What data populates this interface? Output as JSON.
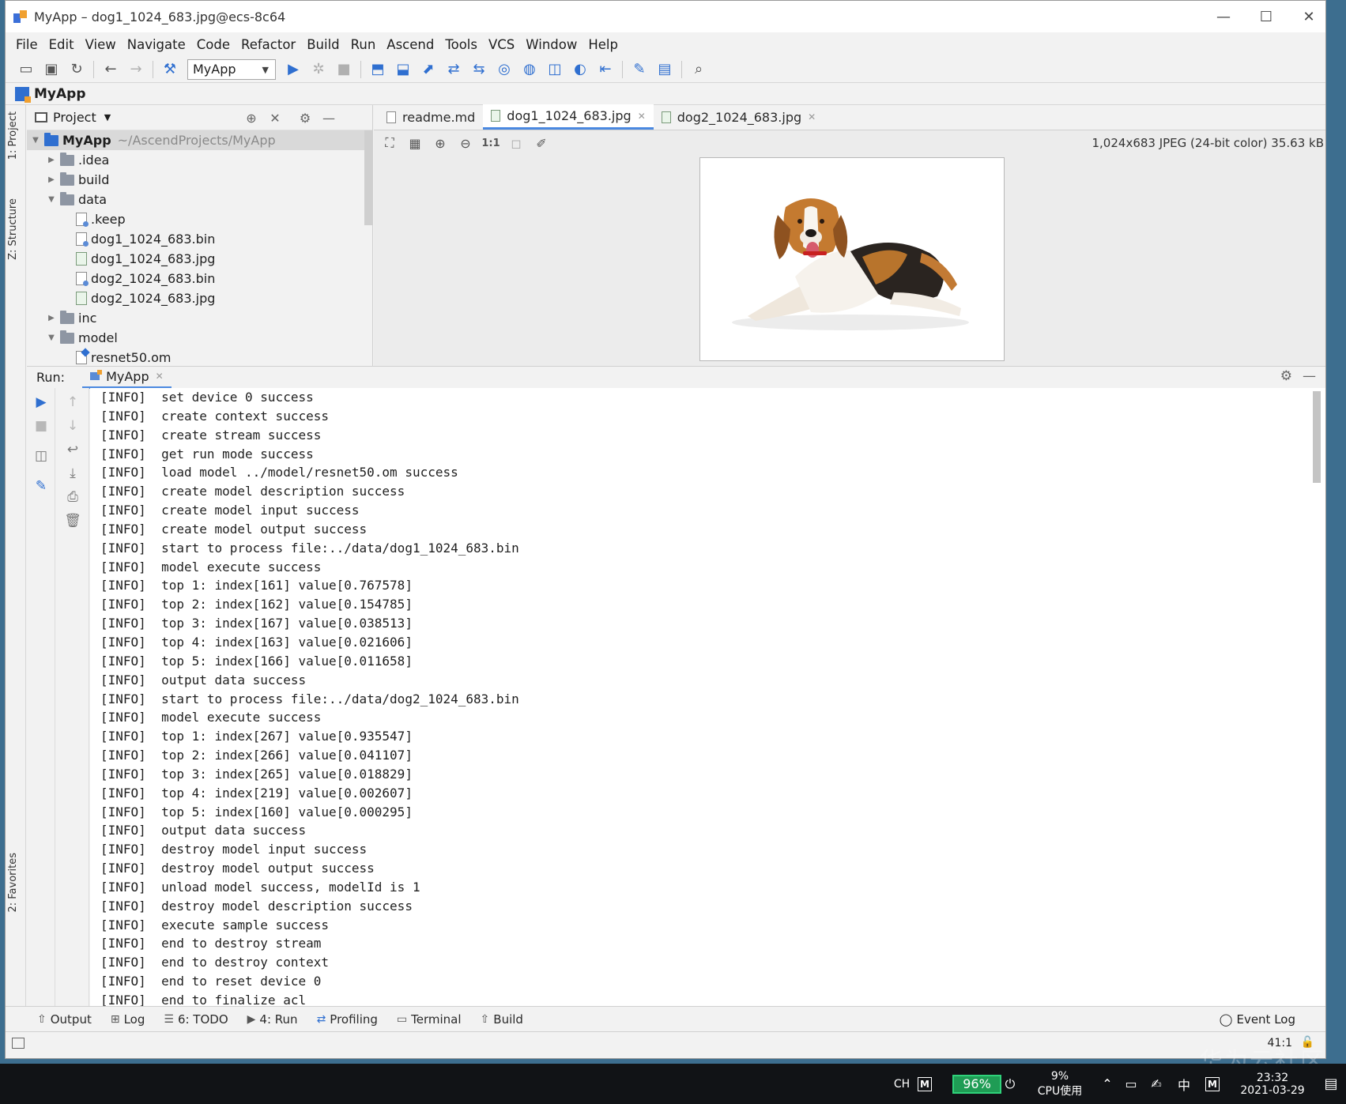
{
  "window": {
    "title": "MyApp – dog1_1024_683.jpg@ecs-8c64",
    "minimize": "—",
    "maximize": "☐",
    "close": "✕"
  },
  "menu": [
    "File",
    "Edit",
    "View",
    "Navigate",
    "Code",
    "Refactor",
    "Build",
    "Run",
    "Ascend",
    "Tools",
    "VCS",
    "Window",
    "Help"
  ],
  "toolbar": {
    "config": "MyApp"
  },
  "navbar": {
    "project": "MyApp"
  },
  "side_tabs": {
    "project": "1: Project",
    "structure": "Z: Structure",
    "favorites": "2: Favorites"
  },
  "project_panel": {
    "title": "Project",
    "root_name": "MyApp",
    "root_path": "~/AscendProjects/MyApp",
    "items": [
      {
        "name": ".idea"
      },
      {
        "name": "build"
      },
      {
        "name": "data"
      },
      {
        "name": ".keep"
      },
      {
        "name": "dog1_1024_683.bin"
      },
      {
        "name": "dog1_1024_683.jpg"
      },
      {
        "name": "dog2_1024_683.bin"
      },
      {
        "name": "dog2_1024_683.jpg"
      },
      {
        "name": "inc"
      },
      {
        "name": "model"
      },
      {
        "name": "resnet50.om"
      }
    ]
  },
  "editor": {
    "tabs": [
      {
        "label": "readme.md"
      },
      {
        "label": "dog1_1024_683.jpg"
      },
      {
        "label": "dog2_1024_683.jpg"
      }
    ],
    "image_info": "1,024x683 JPEG (24-bit color) 35.63 kB",
    "zoom_actual": "1:1"
  },
  "run": {
    "label": "Run:",
    "tab": "MyApp",
    "lines": [
      "[INFO]  set device 0 success",
      "[INFO]  create context success",
      "[INFO]  create stream success",
      "[INFO]  get run mode success",
      "[INFO]  load model ../model/resnet50.om success",
      "[INFO]  create model description success",
      "[INFO]  create model input success",
      "[INFO]  create model output success",
      "[INFO]  start to process file:../data/dog1_1024_683.bin",
      "[INFO]  model execute success",
      "[INFO]  top 1: index[161] value[0.767578]",
      "[INFO]  top 2: index[162] value[0.154785]",
      "[INFO]  top 3: index[167] value[0.038513]",
      "[INFO]  top 4: index[163] value[0.021606]",
      "[INFO]  top 5: index[166] value[0.011658]",
      "[INFO]  output data success",
      "[INFO]  start to process file:../data/dog2_1024_683.bin",
      "[INFO]  model execute success",
      "[INFO]  top 1: index[267] value[0.935547]",
      "[INFO]  top 2: index[266] value[0.041107]",
      "[INFO]  top 3: index[265] value[0.018829]",
      "[INFO]  top 4: index[219] value[0.002607]",
      "[INFO]  top 5: index[160] value[0.000295]",
      "[INFO]  output data success",
      "[INFO]  destroy model input success",
      "[INFO]  destroy model output success",
      "[INFO]  unload model success, modelId is 1",
      "[INFO]  destroy model description success",
      "[INFO]  execute sample success",
      "[INFO]  end to destroy stream",
      "[INFO]  end to destroy context",
      "[INFO]  end to reset device 0",
      "[INFO]  end to finalize acl"
    ]
  },
  "bottom_tabs": {
    "output": "Output",
    "log": "Log",
    "todo": "6: TODO",
    "run": "4: Run",
    "profiling": "Profiling",
    "terminal": "Terminal",
    "build": "Build",
    "event_log": "Event Log"
  },
  "status": {
    "position": "41:1"
  },
  "taskbar": {
    "lang": "CH",
    "ime_m": "M",
    "battery": "96%",
    "cpu_percent": "9%",
    "cpu_label": "CPU使用",
    "ime_zh": "中",
    "time": "23:32",
    "date": "2021-03-29"
  },
  "watermark": "华为云社区"
}
